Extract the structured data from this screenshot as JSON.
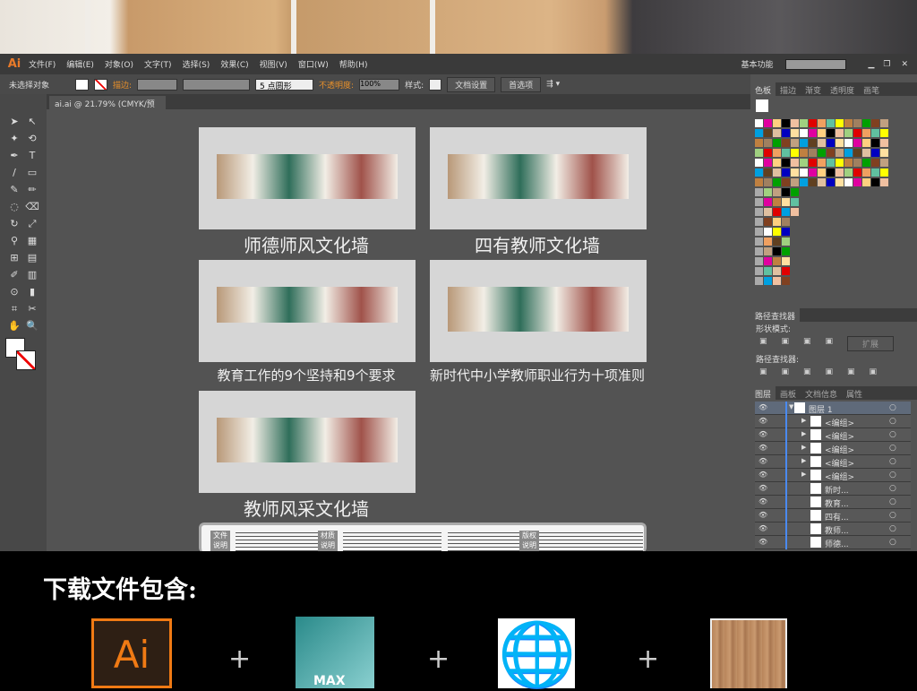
{
  "app": {
    "logo": "Ai",
    "menu": [
      "文件(F)",
      "编辑(E)",
      "对象(O)",
      "文字(T)",
      "选择(S)",
      "效果(C)",
      "视图(V)",
      "窗口(W)",
      "帮助(H)"
    ],
    "workspace": "基本功能",
    "search_placeholder": ""
  },
  "control": {
    "selection": "未选择对象",
    "stroke_label": "描边:",
    "brush": "5 点圆形",
    "opacity_label": "不透明度:",
    "opacity": "100%",
    "style_label": "样式:",
    "doc_setup": "文档设置",
    "prefs": "首选项"
  },
  "doc_tab": {
    "title": "ai.ai @ 21.79% (CMYK/预览)",
    "close": "×"
  },
  "artboards": [
    {
      "caption": "师德师风文化墙"
    },
    {
      "caption": "四有教师文化墙"
    },
    {
      "caption": "教育工作的9个坚持和9个要求"
    },
    {
      "caption": "新时代中小学教师职业行为十项准则"
    },
    {
      "caption": "教师风采文化墙"
    }
  ],
  "info_box": {
    "labels": [
      "文件说明",
      "材质说明",
      "版权说明"
    ]
  },
  "panels": {
    "swatch_tabs": [
      "色板",
      "描边",
      "渐变",
      "透明度",
      "画笔"
    ],
    "pathfinder_tab": "路径查找器",
    "shape_modes": "形状模式:",
    "expand": "扩展",
    "pathfinders": "路径查找器:",
    "layer_tabs": [
      "图层",
      "画板",
      "文档信息",
      "属性"
    ],
    "layers": [
      {
        "name": "图层 1",
        "level": 0,
        "expanded": true
      },
      {
        "name": "<编组>",
        "level": 1
      },
      {
        "name": "<编组>",
        "level": 1
      },
      {
        "name": "<编组>",
        "level": 1
      },
      {
        "name": "<编组>",
        "level": 1
      },
      {
        "name": "<编组>",
        "level": 1
      },
      {
        "name": "新时...",
        "level": 1
      },
      {
        "name": "教育...",
        "level": 1
      },
      {
        "name": "四有...",
        "level": 1
      },
      {
        "name": "教师...",
        "level": 1
      },
      {
        "name": "师德...",
        "level": 1
      }
    ]
  },
  "download": {
    "title": "下载文件包含:",
    "items": [
      "Ai",
      "MAX",
      "web",
      "wood-texture"
    ],
    "plus": "+"
  },
  "colors": {
    "accent": "#e87a2a",
    "layer_blue": "#4a8af0"
  }
}
